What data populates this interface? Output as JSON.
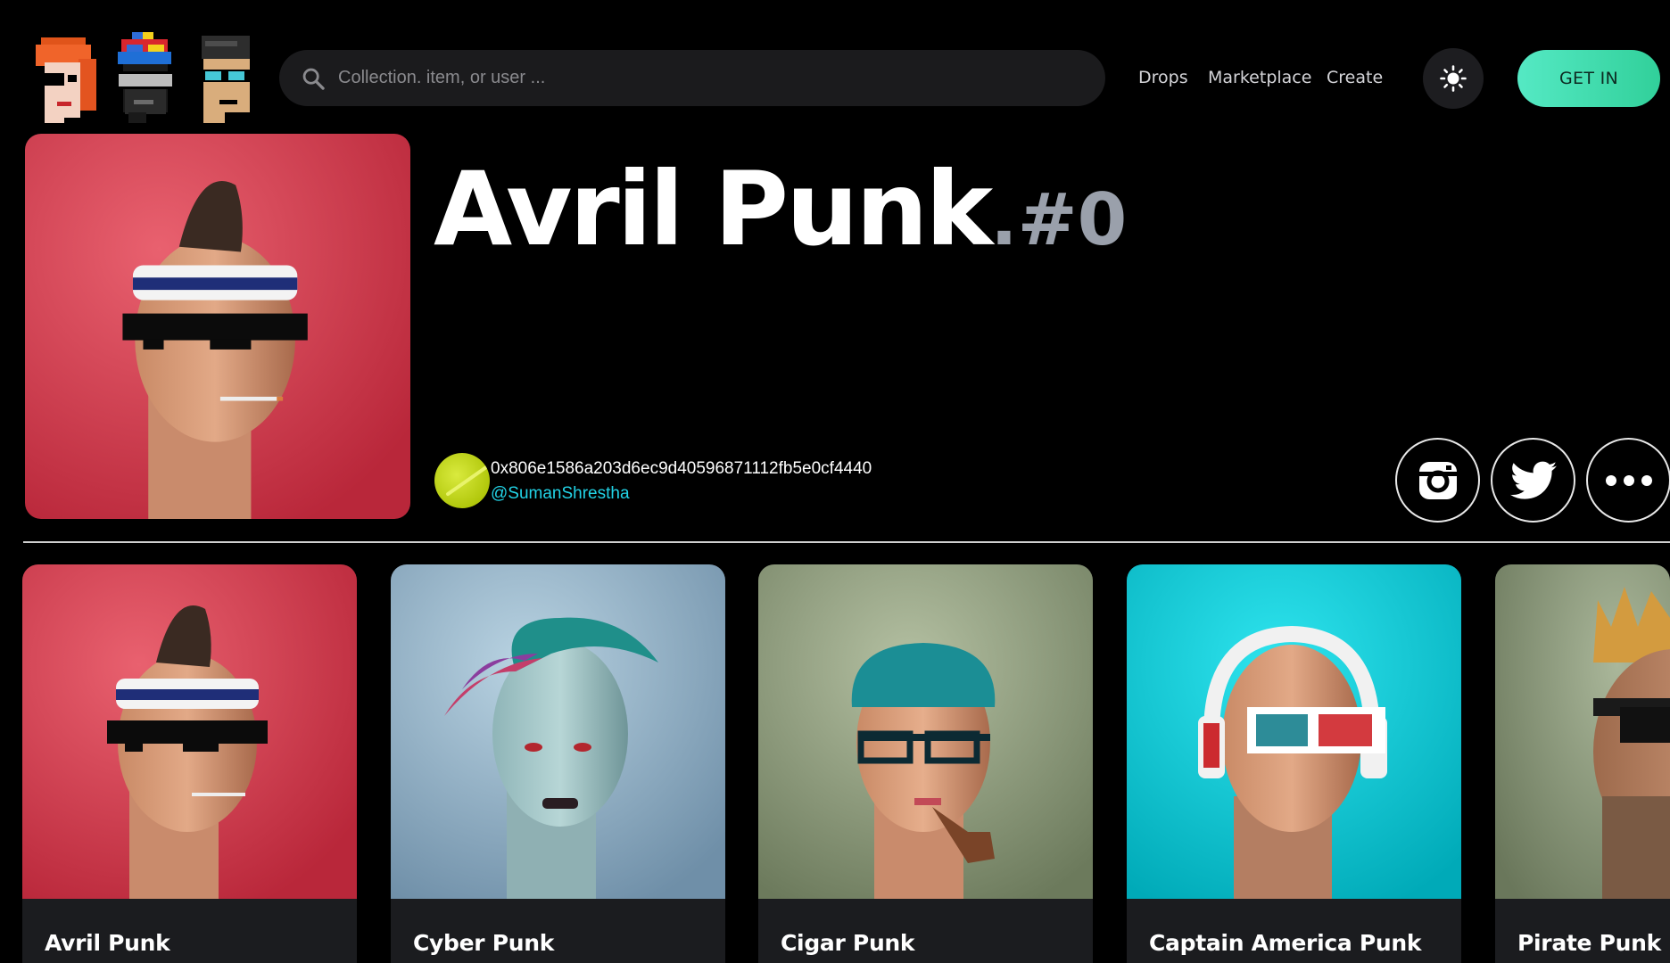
{
  "header": {
    "logo_icons": [
      "punk-redhead-icon",
      "punk-propeller-cap-icon",
      "punk-glasses-icon"
    ],
    "search": {
      "placeholder": "Collection. item, or user ...",
      "value": ""
    },
    "nav": {
      "drops": "Drops",
      "marketplace": "Marketplace",
      "create": "Create"
    },
    "theme_icon": "sun-icon",
    "cta": "GET IN"
  },
  "hero": {
    "name": "Avril Punk",
    "separator": ".",
    "token": "#0",
    "owner": {
      "address": "0x806e1586a203d6ec9d40596871112fb5e0cf4440",
      "handle": "@SumanShrestha"
    },
    "social_icons": [
      "instagram-icon",
      "twitter-icon",
      "more-icon"
    ]
  },
  "cards": [
    {
      "title": "Avril Punk"
    },
    {
      "title": "Cyber Punk"
    },
    {
      "title": "Cigar Punk"
    },
    {
      "title": "Captain America Punk"
    },
    {
      "title": "Pirate Punk"
    }
  ],
  "colors": {
    "background": "#000000",
    "accent": "#3ddbb0",
    "handle": "#22d3e6",
    "search_bg": "#1b1b1d",
    "card_bg": "#1b1c1f"
  }
}
